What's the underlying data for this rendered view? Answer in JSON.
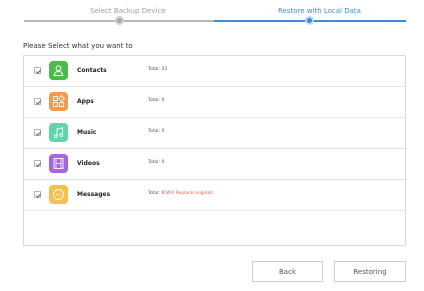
{
  "stepper": {
    "step1_label": "Select Backup Device",
    "step2_label": "Restore with Local Data"
  },
  "prompt": "Please Select what you want to",
  "items": [
    {
      "name": "Contacts",
      "total": "Total: 33",
      "note": "",
      "checked": true,
      "icon": "contacts-icon",
      "color": "#4cba4c"
    },
    {
      "name": "Apps",
      "total": "Total: 0",
      "note": "",
      "checked": true,
      "icon": "apps-icon",
      "color": "#f59a4a"
    },
    {
      "name": "Music",
      "total": "Total: 0",
      "note": "",
      "checked": true,
      "icon": "music-icon",
      "color": "#5ed6a8"
    },
    {
      "name": "Videos",
      "total": "Total: 0",
      "note": "",
      "checked": true,
      "icon": "videos-icon",
      "color": "#a566e0"
    },
    {
      "name": "Messages",
      "total": "Total: 0",
      "note": "(Will Replace original)",
      "checked": true,
      "icon": "messages-icon",
      "color": "#f5c04e"
    }
  ],
  "buttons": {
    "back": "Back",
    "restoring": "Restoring"
  },
  "colors": {
    "accent": "#3a8fd8",
    "warning": "#e8584a"
  }
}
